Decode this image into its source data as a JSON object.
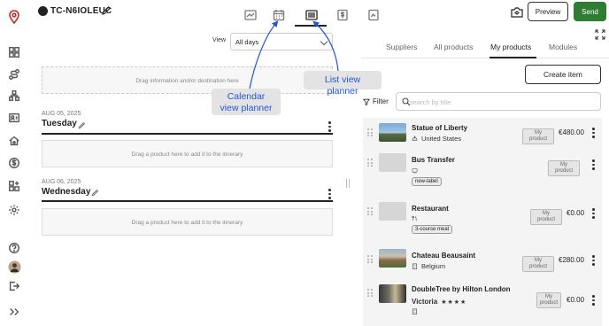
{
  "header": {
    "trip_code": "TC-N6IOLEUC",
    "preview_label": "Preview",
    "send_label": "Send"
  },
  "colors": {
    "send": "#2e7d32",
    "annotation_text": "#2254d6",
    "annotation_bg": "#e3e3e3"
  },
  "view": {
    "label": "View",
    "selected": "All days"
  },
  "itinerary": {
    "drop_hint": "Drag information and/or destination here",
    "days": [
      {
        "date": "AUG 05, 2025",
        "name": "Tuesday",
        "drop_hint": "Drag a product here to add it to the itinerary"
      },
      {
        "date": "AUG 06, 2025",
        "name": "Wednesday",
        "drop_hint": "Drag a product here to add it to the itinerary"
      }
    ]
  },
  "annotations": {
    "calendar": "Calendar view planner",
    "list": "List view planner"
  },
  "right": {
    "tabs": [
      "Suppliers",
      "All products",
      "My products",
      "Modules"
    ],
    "active_tab": "My products",
    "create_label": "Create item",
    "filter_label": "Filter",
    "search_placeholder": "search by title",
    "products": [
      {
        "name": "Statue of Liberty",
        "sub": "United States",
        "badge": "My product",
        "price": "€480.00",
        "tag": ""
      },
      {
        "name": "Bus Transfer",
        "sub": "",
        "badge": "My product",
        "price": "",
        "tag": "new-label"
      },
      {
        "name": "Restaurant",
        "sub": "",
        "badge": "My product",
        "price": "€0.00",
        "tag": "3-course meal"
      },
      {
        "name": "Chateau Beausaint",
        "sub": "Belgium",
        "badge": "My product",
        "price": "€280.00",
        "tag": ""
      },
      {
        "name": "DoubleTree by Hilton London",
        "sub": "Victoria",
        "stars": "★★★★",
        "badge": "My product",
        "price": "€0.00",
        "tag": ""
      }
    ]
  }
}
